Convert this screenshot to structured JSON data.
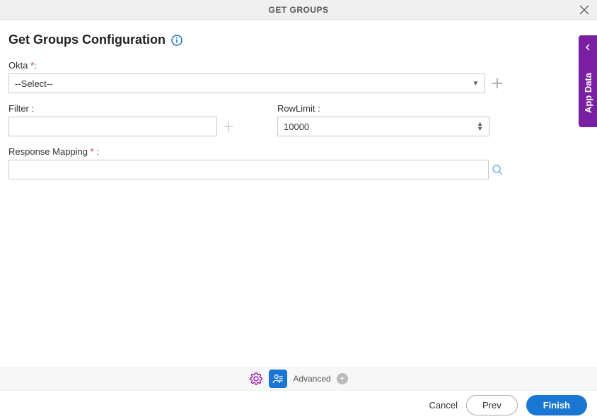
{
  "header": {
    "title": "GET GROUPS"
  },
  "page": {
    "title": "Get Groups Configuration"
  },
  "sideTab": {
    "label": "App Data"
  },
  "form": {
    "okta": {
      "label": "Okta",
      "required_marker": "*",
      "colon": ":",
      "selected": "--Select--"
    },
    "filter": {
      "label": "Filter :",
      "value": ""
    },
    "rowlimit": {
      "label": "RowLimit :",
      "value": "10000"
    },
    "response_mapping": {
      "label": "Response Mapping ",
      "required_marker": "*",
      "colon": " :",
      "value": ""
    }
  },
  "toolbar": {
    "advanced": "Advanced"
  },
  "footer": {
    "cancel": "Cancel",
    "prev": "Prev",
    "finish": "Finish"
  }
}
